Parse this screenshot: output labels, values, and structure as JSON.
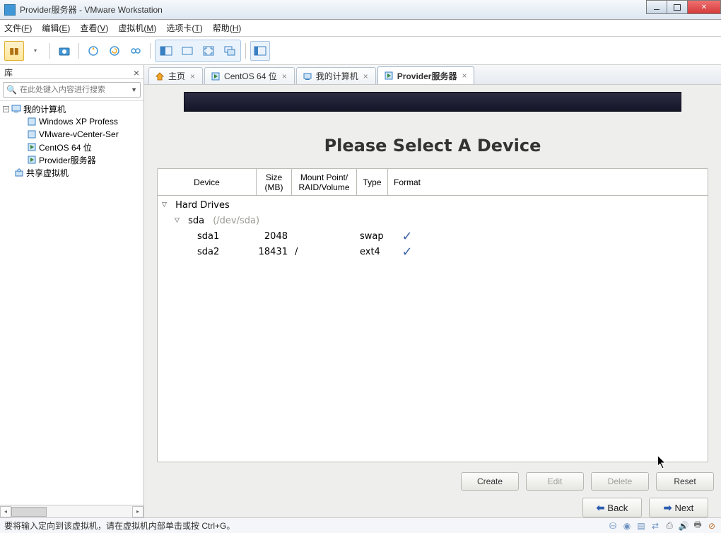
{
  "window": {
    "title": "Provider服务器 - VMware Workstation"
  },
  "menu": {
    "file": "文件(F)",
    "edit": "编辑(E)",
    "view": "查看(V)",
    "vm": "虚拟机(M)",
    "tabs": "选项卡(T)",
    "help": "帮助(H)"
  },
  "sidebar": {
    "header": "库",
    "search_placeholder": "在此处键入内容进行搜索",
    "root": "我的计算机",
    "items": [
      {
        "label": "Windows XP Profess"
      },
      {
        "label": "VMware-vCenter-Ser"
      },
      {
        "label": "CentOS 64 位"
      },
      {
        "label": "Provider服务器"
      }
    ],
    "shared": "共享虚拟机"
  },
  "tabs": [
    {
      "label": "主页",
      "icon": "home",
      "closable": true
    },
    {
      "label": "CentOS 64 位",
      "icon": "vm",
      "closable": true
    },
    {
      "label": "我的计算机",
      "icon": "computer",
      "closable": true
    },
    {
      "label": "Provider服务器",
      "icon": "vm",
      "closable": true,
      "active": true
    }
  ],
  "vm": {
    "title": "Please Select A Device",
    "columns": {
      "device": "Device",
      "size": "Size\n(MB)",
      "mount": "Mount Point/\nRAID/Volume",
      "type": "Type",
      "format": "Format"
    },
    "group": "Hard Drives",
    "disk": {
      "name": "sda",
      "path": "(/dev/sda)"
    },
    "partitions": [
      {
        "name": "sda1",
        "size": "2048",
        "mount": "",
        "type": "swap",
        "format": true
      },
      {
        "name": "sda2",
        "size": "18431",
        "mount": "/",
        "type": "ext4",
        "format": true
      }
    ],
    "buttons": {
      "create": "Create",
      "edit": "Edit",
      "delete": "Delete",
      "reset": "Reset"
    },
    "nav": {
      "back": "Back",
      "next": "Next"
    }
  },
  "status": {
    "text": "要将输入定向到该虚拟机，请在虚拟机内部单击或按 Ctrl+G。"
  }
}
